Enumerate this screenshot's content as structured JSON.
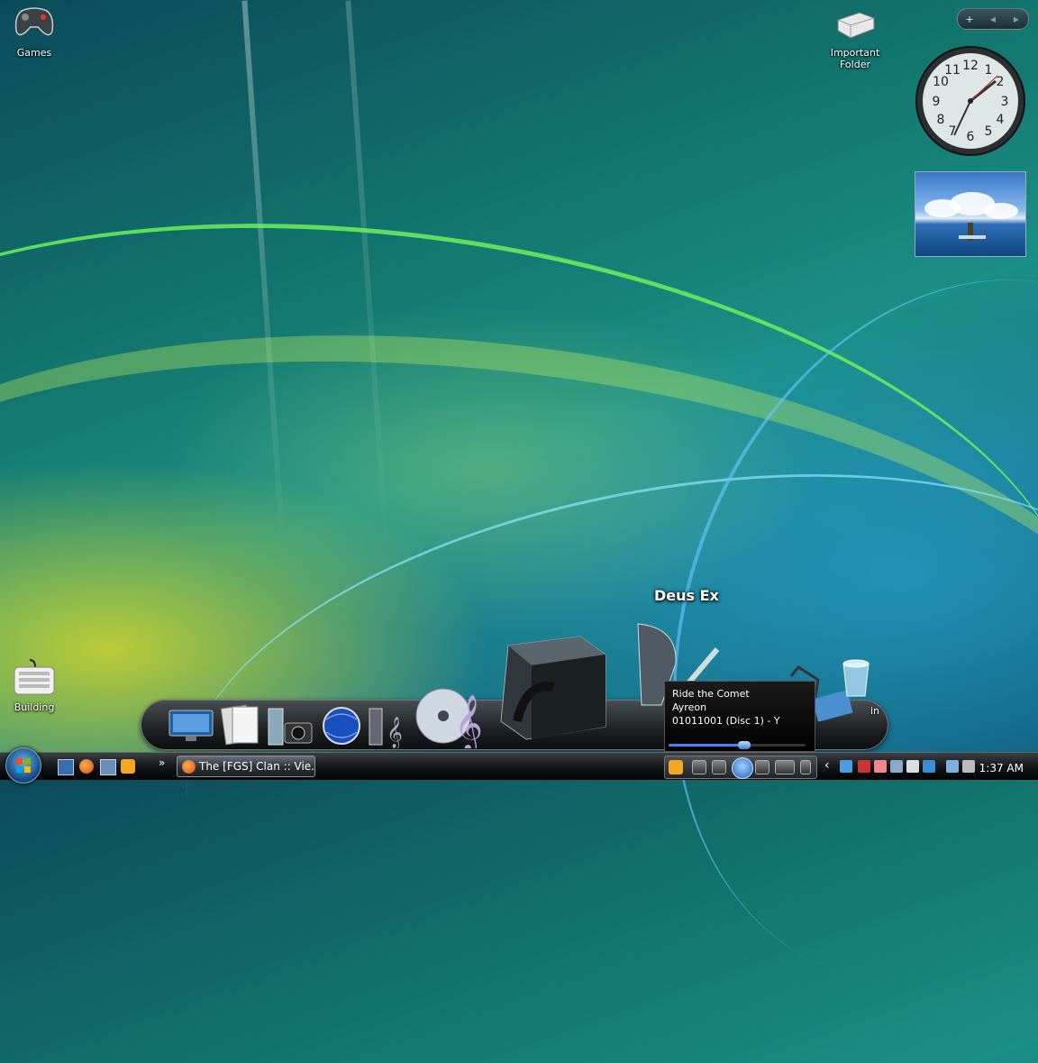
{
  "desktop": {
    "icons": [
      {
        "label": "Games",
        "icon": "gamepad-icon"
      },
      {
        "label": "Important Folder",
        "icon": "drive-icon"
      },
      {
        "label": "Building",
        "icon": "keyboard-icon"
      }
    ]
  },
  "sidebar": {
    "add_symbol": "+",
    "prev_symbol": "◀",
    "next_symbol": "▶",
    "clock_numbers": [
      "12",
      "1",
      "2",
      "3",
      "4",
      "5",
      "6",
      "7",
      "8",
      "9",
      "10",
      "11"
    ]
  },
  "dock": {
    "hover_label": "Deus Ex",
    "partial_label": "in"
  },
  "now_playing": {
    "title": "Ride the Comet",
    "artist": "Ayreon",
    "album": "01011001 (Disc 1) - Y",
    "progress": 0.55
  },
  "taskbar": {
    "overflow_symbol": "»",
    "window_title": "The [FGS] Clan :: Vie...",
    "tray_chevron": "‹",
    "time": "1:37 AM"
  }
}
